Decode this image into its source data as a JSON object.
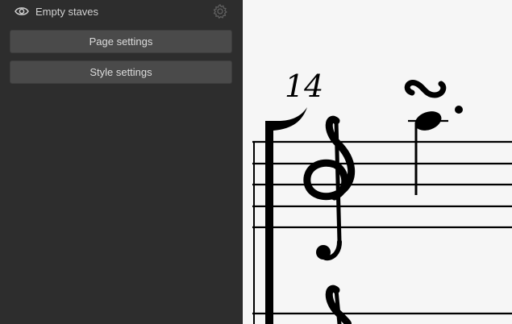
{
  "panel": {
    "empty_staves": {
      "label": "Empty staves",
      "visibility_icon": "eye-icon",
      "settings_icon": "gear-icon"
    },
    "buttons": {
      "page_settings": "Page settings",
      "style_settings": "Style settings"
    }
  },
  "score": {
    "measure_number": "14",
    "clef": "treble-clef",
    "ornament": "turn"
  },
  "colors": {
    "panel_background": "#2d2d2d",
    "button_background": "#4a4a4a",
    "text": "#d2d2d2",
    "score_background": "#f6f6f6",
    "notation": "#000000"
  }
}
